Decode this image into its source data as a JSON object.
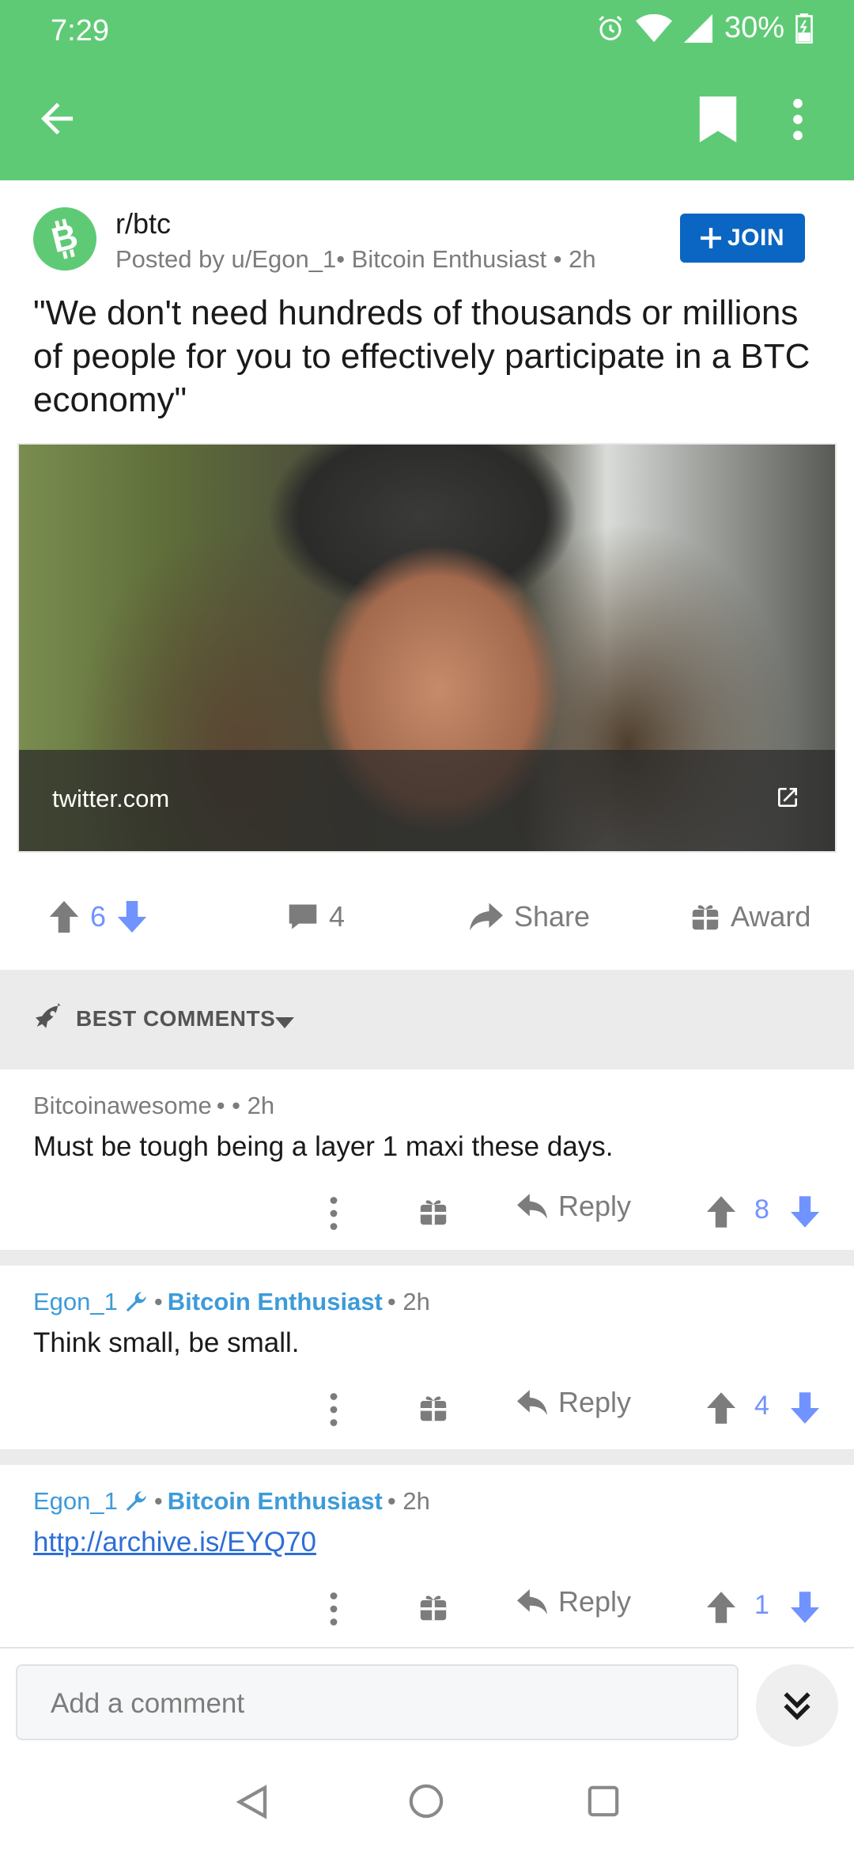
{
  "status_bar": {
    "time": "7:29",
    "battery": "30%"
  },
  "app_bar": {
    "back_icon": "arrow-left-icon",
    "bookmark_icon": "bookmark-icon",
    "more_icon": "more-vert-icon"
  },
  "post": {
    "subreddit": "r/btc",
    "meta": "Posted by u/Egon_1• Bitcoin Enthusiast • 2h",
    "join_label": "JOIN",
    "title": "\"We don't need hundreds of thousands or millions of people for you to effectively participate in a BTC economy\"",
    "link_domain": "twitter.com",
    "score": "6",
    "comments_count": "4",
    "share_label": "Share",
    "award_label": "Award"
  },
  "comments_header": {
    "sort_label": "BEST COMMENTS"
  },
  "comments": [
    {
      "author": "Bitcoinawesome",
      "meta": "• • 2h",
      "body": "Must be tough being a layer 1 maxi these days.",
      "reply_label": "Reply",
      "score": "8"
    },
    {
      "author": "Egon_1",
      "flair": "Bitcoin Enthusiast",
      "age": "• 2h",
      "body": "Think small, be small.",
      "reply_label": "Reply",
      "score": "4"
    },
    {
      "author": "Egon_1",
      "flair": "Bitcoin Enthusiast",
      "age": "• 2h",
      "body": "http://archive.is/EYQ70",
      "reply_label": "Reply",
      "score": "1"
    }
  ],
  "bottom_bar": {
    "placeholder": "Add a comment"
  },
  "colors": {
    "app_green": "#5fca76",
    "join_blue": "#0a66c2",
    "vote_blue": "#7193ff",
    "op_blue": "#3d9bd9"
  }
}
